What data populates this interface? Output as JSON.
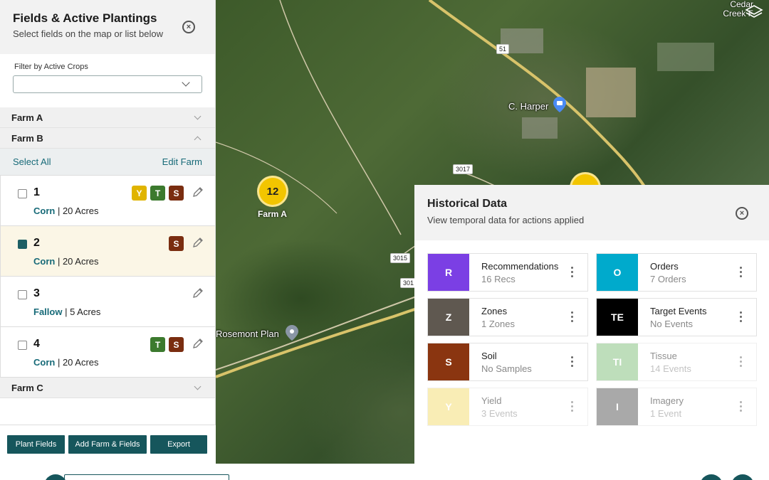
{
  "panel": {
    "title": "Fields & Active Plantings",
    "subtitle": "Select fields on the map or list below",
    "filter_label": "Filter by Active Crops",
    "filter_value": "",
    "farms": {
      "farm_a": "Farm A",
      "farm_b": "Farm B",
      "farm_c": "Farm C"
    },
    "select_all": "Select All",
    "edit_farm": "Edit Farm",
    "fields": [
      {
        "num": "1",
        "crop": "Corn",
        "area": "20 Acres",
        "checked": false,
        "badges": [
          "Y",
          "T",
          "S"
        ]
      },
      {
        "num": "2",
        "crop": "Corn",
        "area": "20 Acres",
        "checked": true,
        "badges": [
          "S"
        ]
      },
      {
        "num": "3",
        "crop": "Fallow",
        "area": "5 Acres",
        "checked": false,
        "badges": []
      },
      {
        "num": "4",
        "crop": "Corn",
        "area": "20 Acres",
        "checked": false,
        "badges": [
          "T",
          "S"
        ]
      }
    ],
    "buttons": {
      "plant": "Plant Fields",
      "add": "Add Farm & Fields",
      "export": "Export"
    }
  },
  "map": {
    "roads": [
      "51",
      "3017",
      "3015",
      "301"
    ],
    "places": {
      "harper": "C. Harper",
      "rosemont": "Rosemont Plan",
      "cedar_1": "Cedar",
      "cedar_2": "Creek F"
    },
    "cluster": {
      "count": "12",
      "label": "Farm A"
    },
    "cluster_color": "#f2c500"
  },
  "historical": {
    "title": "Historical Data",
    "subtitle": "View temporal data for actions applied",
    "cards": [
      {
        "code": "R",
        "name": "Recommendations",
        "count": "16 Recs",
        "color": "#7b3fe4",
        "enabled": true
      },
      {
        "code": "O",
        "name": "Orders",
        "count": "7 Orders",
        "color": "#00aacc",
        "enabled": true
      },
      {
        "code": "Z",
        "name": "Zones",
        "count": "1 Zones",
        "color": "#5f5850",
        "enabled": true
      },
      {
        "code": "TE",
        "name": "Target Events",
        "count": "No Events",
        "color": "#000000",
        "enabled": true
      },
      {
        "code": "S",
        "name": "Soil",
        "count": "No Samples",
        "color": "#8a3510",
        "enabled": true
      },
      {
        "code": "TI",
        "name": "Tissue",
        "count": "14 Events",
        "color": "#7fbf7a",
        "enabled": false
      },
      {
        "code": "Y",
        "name": "Yield",
        "count": "3 Events",
        "color": "#f5dc6e",
        "enabled": false
      },
      {
        "code": "I",
        "name": "Imagery",
        "count": "1 Event",
        "color": "#555555",
        "enabled": false
      }
    ]
  },
  "colors": {
    "primary": "#16565c",
    "link": "#176a78",
    "selected_row": "#fbf6e6"
  }
}
